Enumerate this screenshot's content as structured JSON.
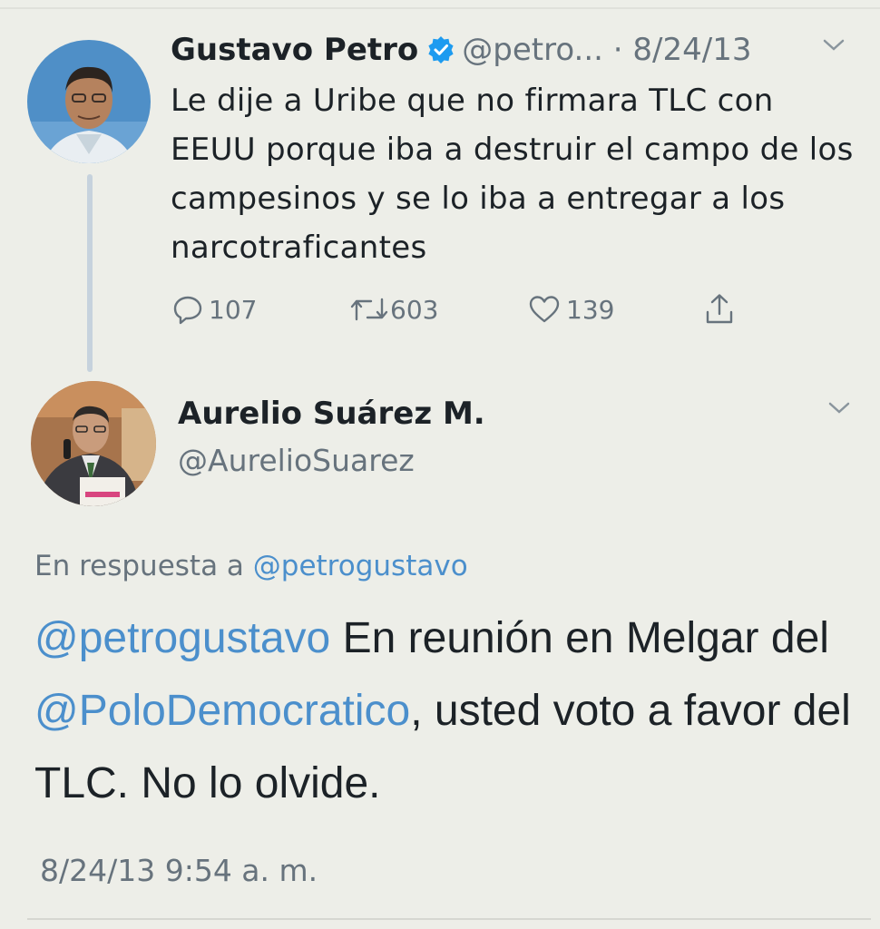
{
  "tweet1": {
    "name": "Gustavo Petro",
    "handle": "@petro...",
    "separator": " · ",
    "date": "8/24/13",
    "text": "Le dije a Uribe que no firmara TLC con EEUU porque iba a destruir el campo de los campesinos y se lo iba a entregar a los narcotraficantes",
    "replies": "107",
    "retweets": "603",
    "likes": "139",
    "verified": true
  },
  "tweet2": {
    "name": "Aurelio Suárez M.",
    "handle": "@AurelioSuarez",
    "reply_prefix": "En respuesta a ",
    "reply_target": "@petrogustavo",
    "mention1": "@petrogustavo",
    "text_part1": " En reunión en Melgar del ",
    "mention2": "@PoloDemocratico",
    "text_part2": ", usted voto a favor del TLC. No lo olvide.",
    "timestamp": "8/24/13 9:54 a. m."
  },
  "colors": {
    "background": "#edeee8",
    "text": "#1c2227",
    "muted": "#67737d",
    "link": "#4b8fcc",
    "verified": "#1d9bf0",
    "thread_line": "#c6d2dd"
  },
  "icons": [
    "verified-badge-icon",
    "chevron-down-icon",
    "reply-icon",
    "retweet-icon",
    "like-icon",
    "share-icon"
  ]
}
